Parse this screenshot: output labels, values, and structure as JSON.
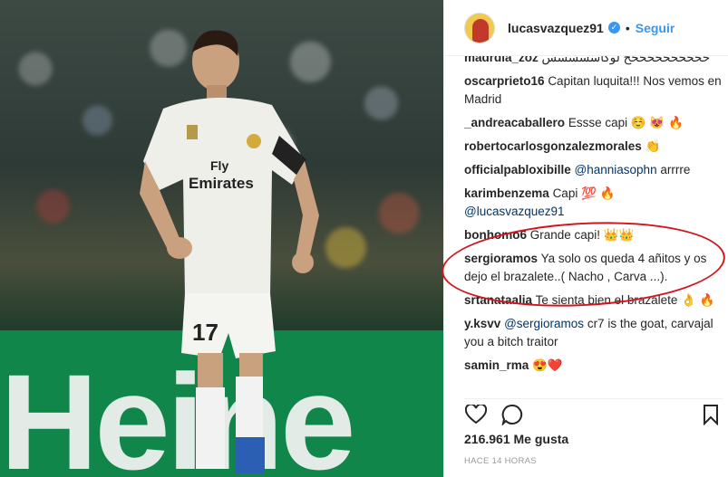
{
  "photo": {
    "banner_text": "Heine",
    "jersey_sponsor_line1": "Fly",
    "jersey_sponsor_line2": "Emirates",
    "shorts_number": "17"
  },
  "header": {
    "username": "lucasvazquez91",
    "dot": "•",
    "follow_label": "Seguir"
  },
  "comments": [
    {
      "user": "madrdia_zoz",
      "text": "خخخخخخخخخخخ لوكاسسسسس"
    },
    {
      "user": "oscarprieto16",
      "text": "Capitan luquita!!! Nos vemos en Madrid"
    },
    {
      "user": "_andreacaballero",
      "text": "Essse capi ☺️ 😻 🔥"
    },
    {
      "user": "robertocarlosgonzalezmorales",
      "text": "👏"
    },
    {
      "user": "officialpabloxibille",
      "text": "arrrre",
      "mention": "@hanniasophn"
    },
    {
      "user": "karimbenzema",
      "text": "Capi 💯 🔥",
      "mention_after": "@lucasvazquez91"
    },
    {
      "user": "bonhomo6",
      "text": "Grande capi! 👑👑"
    },
    {
      "user": "sergioramos",
      "text": "Ya solo os queda 4 añitos y os dejo el brazalete..( Nacho , Carva ...)."
    },
    {
      "user": "srtanataalia",
      "text": "Te sienta bien el brazalete 👌 🔥"
    },
    {
      "user": "y.ksvv",
      "mention": "@sergioramos",
      "text": "cr7 is the goat, carvajal you a bitch traitor"
    },
    {
      "user": "samin_rma",
      "text": "😍❤️"
    }
  ],
  "likes": "216.961 Me gusta",
  "time": "HACE 14 HORAS",
  "colors": {
    "accent": "#3897f0",
    "highlight": "#d2151c",
    "banner": "#11864a"
  }
}
